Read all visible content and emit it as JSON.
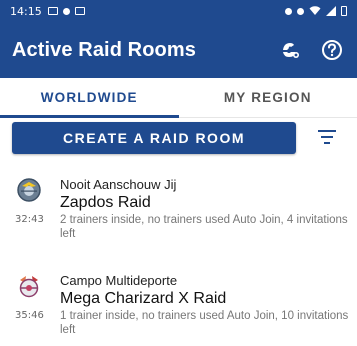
{
  "status_bar": {
    "time": "14:15"
  },
  "app_bar": {
    "title": "Active Raid Rooms",
    "actions": [
      "pokemon-filter-icon",
      "help-icon"
    ]
  },
  "tabs": [
    {
      "label": "WORLDWIDE",
      "active": true
    },
    {
      "label": "MY REGION",
      "active": false
    }
  ],
  "create_button": {
    "label": "CREATE A RAID ROOM"
  },
  "rooms": [
    {
      "location": "Nooit Aanschouw Jij",
      "boss": "Zapdos Raid",
      "timer": "32:43",
      "detail": "2 trainers inside, no trainers used Auto Join, 4 invitations left",
      "icon": "zapdos-raid-icon"
    },
    {
      "location": "Campo Multideporte",
      "boss": "Mega Charizard X Raid",
      "timer": "35:46",
      "detail": "1 trainer inside, no trainers used Auto Join, 10 invitations left",
      "icon": "mega-charizard-raid-icon"
    }
  ],
  "colors": {
    "primary": "#1f4a8f",
    "text_secondary": "#777777"
  }
}
